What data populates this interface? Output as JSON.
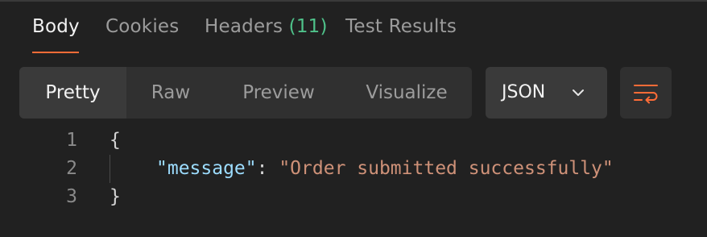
{
  "tabs": [
    {
      "label": "Body",
      "active": true
    },
    {
      "label": "Cookies",
      "active": false
    },
    {
      "label": "Headers",
      "count": "(11)",
      "active": false
    },
    {
      "label": "Test Results",
      "active": false
    }
  ],
  "view_modes": [
    {
      "label": "Pretty",
      "active": true
    },
    {
      "label": "Raw",
      "active": false
    },
    {
      "label": "Preview",
      "active": false
    },
    {
      "label": "Visualize",
      "active": false
    }
  ],
  "format_select": {
    "value": "JSON",
    "icon": "chevron-down-icon"
  },
  "wrap_button": {
    "icon": "wrap-lines-icon"
  },
  "code": {
    "line_numbers": [
      "1",
      "2",
      "3"
    ],
    "open_brace": "{",
    "key": "\"message\"",
    "colon": ": ",
    "value": "\"Order submitted successfully\"",
    "close_brace": "}"
  },
  "colors": {
    "accent": "#ff6c37",
    "count_green": "#4fc28a",
    "json_key": "#9cdcfe",
    "json_string": "#ce9178"
  }
}
